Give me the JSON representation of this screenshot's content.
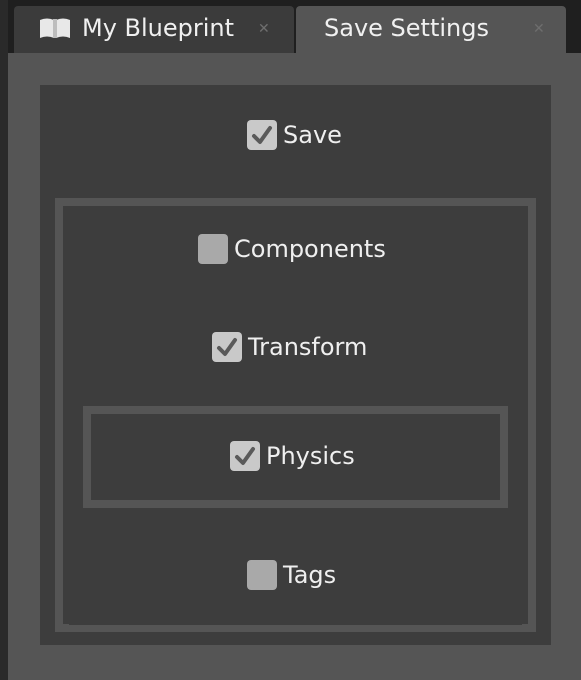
{
  "tabs": [
    {
      "label": "My Blueprint",
      "icon": "book-icon",
      "active": false
    },
    {
      "label": "Save Settings",
      "active": true
    }
  ],
  "options": {
    "save": {
      "label": "Save",
      "checked": true
    },
    "components": {
      "label": "Components",
      "checked": false
    },
    "transform": {
      "label": "Transform",
      "checked": true
    },
    "physics": {
      "label": "Physics",
      "checked": true
    },
    "tags": {
      "label": "Tags",
      "checked": false
    }
  },
  "colors": {
    "background": "#555555",
    "panel": "#3d3d3d",
    "tab_bar": "#1f1f1f",
    "checkbox_checked": "#c9c9c9",
    "checkbox_unchecked": "#a9a9a9"
  }
}
